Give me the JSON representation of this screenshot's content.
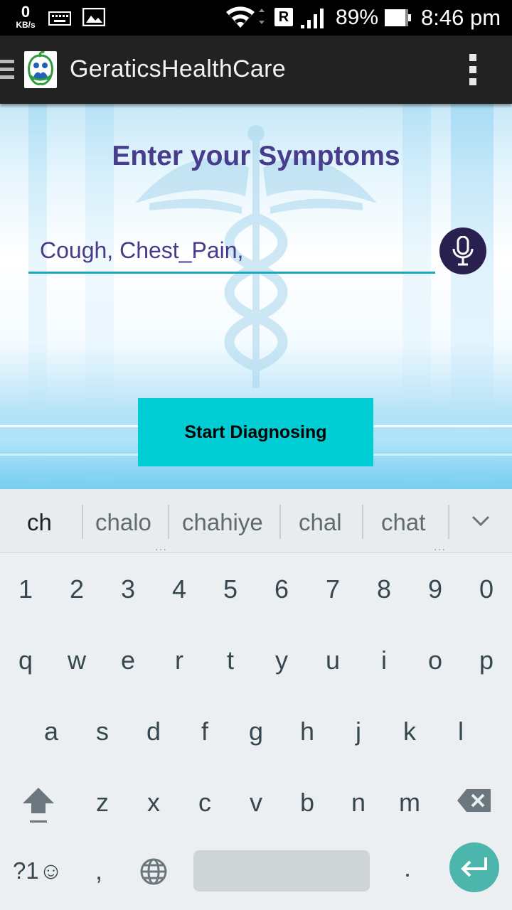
{
  "status_bar": {
    "speed_value": "0",
    "speed_unit": "KB/s",
    "carrier_badge": "R",
    "battery_percent": "89%",
    "time": "8:46 pm",
    "icons": [
      "keyboard-icon",
      "image-icon",
      "wifi-icon",
      "signal-icon",
      "battery-icon"
    ]
  },
  "app_bar": {
    "title": "GeraticsHealthCare",
    "icons": [
      "drawer-icon",
      "app-logo",
      "overflow-menu-icon"
    ]
  },
  "main": {
    "heading": "Enter your Symptoms",
    "symptom_input_value": "Cough, Chest_Pain,",
    "start_button_label": "Start Diagnosing"
  },
  "keyboard": {
    "suggestions": [
      "ch",
      "chalo",
      "chahiye",
      "chal",
      "chat"
    ],
    "number_row": [
      "1",
      "2",
      "3",
      "4",
      "5",
      "6",
      "7",
      "8",
      "9",
      "0"
    ],
    "row1": [
      "q",
      "w",
      "e",
      "r",
      "t",
      "y",
      "u",
      "i",
      "o",
      "p"
    ],
    "row2": [
      "a",
      "s",
      "d",
      "f",
      "g",
      "h",
      "j",
      "k",
      "l"
    ],
    "row3": [
      "z",
      "x",
      "c",
      "v",
      "b",
      "n",
      "m"
    ],
    "symbols_label": "?1☺",
    "comma": ",",
    "period": ".",
    "accent_color": "#4db6ac"
  },
  "colors": {
    "heading": "#483c8c",
    "input_underline": "#1aa5c0",
    "start_button": "#00cdd3",
    "mic_button": "#2a2050"
  }
}
